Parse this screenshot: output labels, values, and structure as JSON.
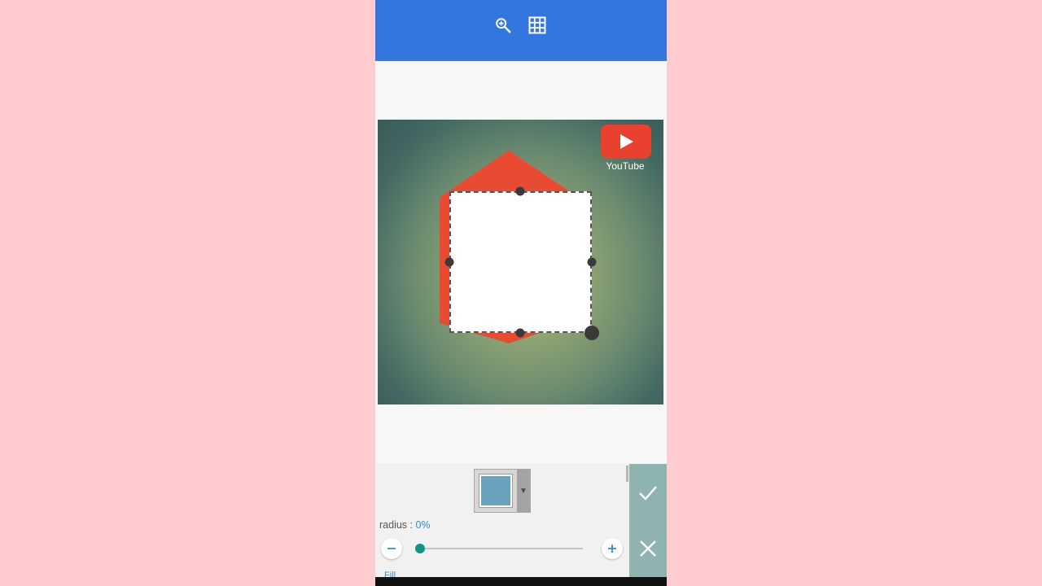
{
  "topbar": {
    "color": "#3476e0",
    "icons": [
      "zoom-in-icon",
      "grid-icon"
    ]
  },
  "canvas": {
    "logo": {
      "icon": "youtube-play-icon",
      "label": "YouTube",
      "color": "#e8412f"
    },
    "shape_color": "#e84a32",
    "selection_fill": "#ffffff"
  },
  "shape_tool": {
    "swatch_color": "#6aa2bd",
    "radius_label": "radius : ",
    "radius_value": "0%",
    "radius_level": 0,
    "fill_label": "Fill"
  },
  "actions": {
    "confirm_icon": "check-icon",
    "cancel_icon": "close-icon",
    "color": "#8fb3ae"
  }
}
